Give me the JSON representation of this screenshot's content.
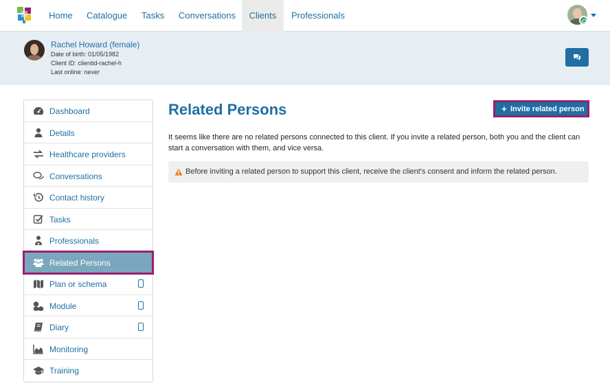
{
  "nav": {
    "items": [
      {
        "label": "Home"
      },
      {
        "label": "Catalogue"
      },
      {
        "label": "Tasks"
      },
      {
        "label": "Conversations"
      },
      {
        "label": "Clients",
        "active": true
      },
      {
        "label": "Professionals"
      }
    ],
    "logo_icon": "app-logo-icon",
    "user_icon": "user-avatar"
  },
  "client": {
    "name": "Rachel Howard (female)",
    "dob": "Date of birth: 01/05/1982",
    "client_id": "Client ID: clientid-rachel-h",
    "last_online": "Last online: never"
  },
  "sidebar": {
    "items": [
      {
        "label": "Dashboard",
        "icon": "dashboard-icon"
      },
      {
        "label": "Details",
        "icon": "user-icon"
      },
      {
        "label": "Healthcare providers",
        "icon": "exchange-icon"
      },
      {
        "label": "Conversations",
        "icon": "chat-icon"
      },
      {
        "label": "Contact history",
        "icon": "history-icon"
      },
      {
        "label": "Tasks",
        "icon": "checkbox-icon"
      },
      {
        "label": "Professionals",
        "icon": "doctor-icon"
      },
      {
        "label": "Related Persons",
        "icon": "group-icon",
        "active": true
      },
      {
        "label": "Plan or schema",
        "icon": "map-icon",
        "mobile": true
      },
      {
        "label": "Module",
        "icon": "cubes-icon",
        "mobile": true
      },
      {
        "label": "Diary",
        "icon": "book-icon",
        "mobile": true
      },
      {
        "label": "Monitoring",
        "icon": "area-chart-icon"
      },
      {
        "label": "Training",
        "icon": "graduation-cap-icon"
      }
    ]
  },
  "main": {
    "title": "Related Persons",
    "invite_label": "Invite related person",
    "info": "It seems like there are no related persons connected to this client. If you invite a related person, both you and the client can start a conversation with them, and vice versa.",
    "warning": "Before inviting a related person to support this client, receive the client's consent and inform the related person."
  },
  "colors": {
    "primary": "#1f6fa3",
    "highlight": "#9b1f6f",
    "active_item": "#7aa7bd",
    "warning": "#e67e22"
  }
}
